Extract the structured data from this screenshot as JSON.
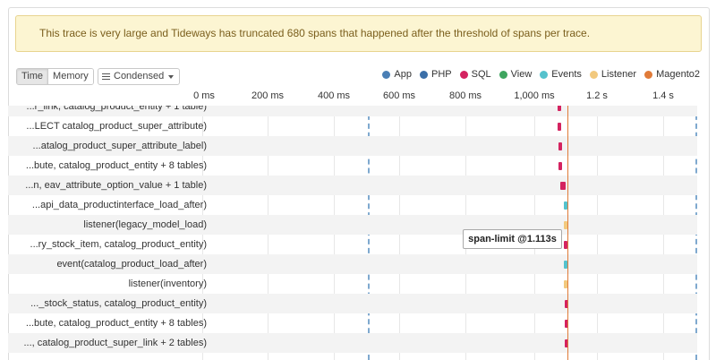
{
  "alert": {
    "text": "This trace is very large and Tideways has truncated 680 spans that happened after the threshold of spans per trace."
  },
  "view_toggle": {
    "time": "Time",
    "memory": "Memory",
    "active": "Time"
  },
  "condensed": {
    "label": "Condensed"
  },
  "legend": [
    {
      "label": "App",
      "color": "#4a7fb5",
      "icon": "dot"
    },
    {
      "label": "PHP",
      "color": "#3b6fa8",
      "icon": "dot"
    },
    {
      "label": "SQL",
      "color": "#d42360",
      "icon": "dot"
    },
    {
      "label": "View",
      "color": "#3ea55f",
      "icon": "dot"
    },
    {
      "label": "Events",
      "color": "#55c2cd",
      "icon": "dot"
    },
    {
      "label": "Listener",
      "color": "#f2c97e",
      "icon": "dot"
    },
    {
      "label": "Magento2",
      "color": "#e07b39",
      "icon": "dot"
    }
  ],
  "axis_ticks": [
    "0 ms",
    "200 ms",
    "400 ms",
    "600 ms",
    "800 ms",
    "1,000 ms",
    "1.2 s",
    "1.4 s"
  ],
  "spans": [
    {
      "label": "...r_link, catalog_product_entity + 1 table)",
      "type": "sql"
    },
    {
      "label": "...LECT catalog_product_super_attribute)",
      "type": "sql"
    },
    {
      "label": "...atalog_product_super_attribute_label)",
      "type": "sql"
    },
    {
      "label": "...bute, catalog_product_entity + 8 tables)",
      "type": "sql"
    },
    {
      "label": "...n, eav_attribute_option_value + 1 table)",
      "type": "sql"
    },
    {
      "label": "...api_data_productinterface_load_after)",
      "type": "events"
    },
    {
      "label": "listener(legacy_model_load)",
      "type": "listener"
    },
    {
      "label": "...ry_stock_item, catalog_product_entity)",
      "type": "sql"
    },
    {
      "label": "event(catalog_product_load_after)",
      "type": "events"
    },
    {
      "label": "listener(inventory)",
      "type": "listener"
    },
    {
      "label": "..._stock_status, catalog_product_entity)",
      "type": "sql"
    },
    {
      "label": "...bute, catalog_product_entity + 8 tables)",
      "type": "sql"
    },
    {
      "label": "..., catalog_product_super_link + 2 tables)",
      "type": "sql"
    }
  ],
  "span_limit": {
    "label": "span-limit @1.113s"
  }
}
